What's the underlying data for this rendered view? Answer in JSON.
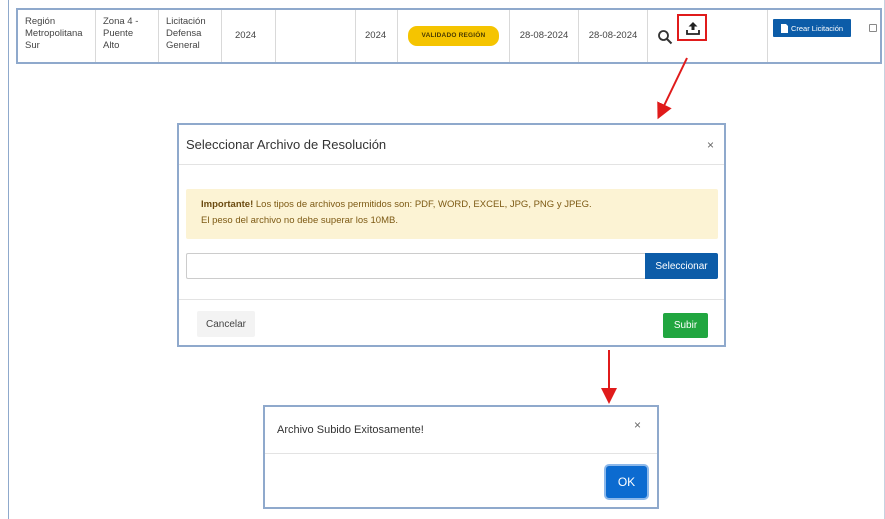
{
  "table_row": {
    "region": "Región Metropolitana Sur",
    "zona": "Zona 4 - Puente Alto",
    "licitacion": "Licitación Defensa General",
    "year_1": "2024",
    "year_2": "2024",
    "status_badge": "VALIDADO REGIÓN",
    "date_1": "28-08-2024",
    "date_2": "28-08-2024",
    "crear_button": "Crear Licitación",
    "icons": [
      "search-icon",
      "upload-icon",
      "document-icon"
    ],
    "colors": {
      "badge": "#f5c400",
      "primary": "#0c5ca8",
      "highlight": "#e01b1b"
    }
  },
  "upload_modal": {
    "title": "Seleccionar Archivo de Resolución",
    "close": "×",
    "alert_strong": "Importante!",
    "alert_line1": " Los tipos de archivos permitidos son: PDF, WORD, EXCEL, JPG, PNG y JPEG.",
    "alert_line2": "El peso del archivo no debe superar los 10MB.",
    "file_value": "",
    "select_button": "Seleccionar",
    "cancel_button": "Cancelar",
    "submit_button": "Subir",
    "colors": {
      "alert_bg": "#fcf3d4",
      "submit": "#21a640"
    }
  },
  "success_modal": {
    "title": "Archivo Subido Exitosamente!",
    "close": "×",
    "ok_button": "OK",
    "colors": {
      "ok": "#0c6bd0"
    }
  }
}
